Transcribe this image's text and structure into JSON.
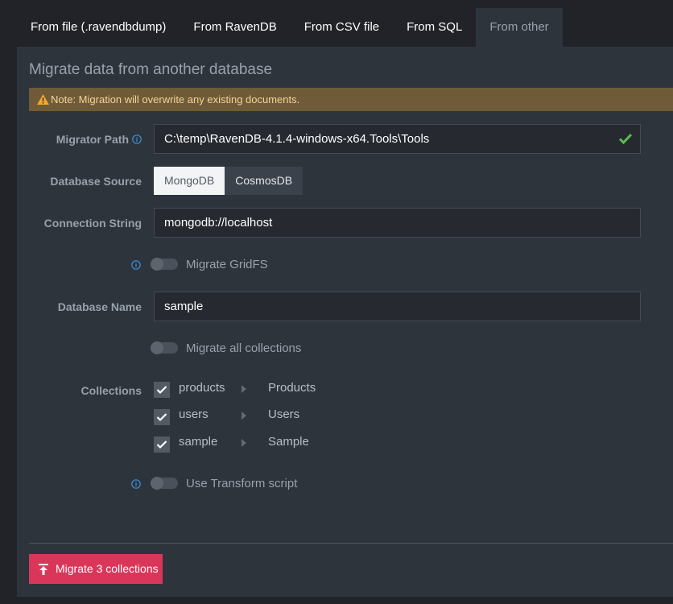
{
  "tabs": [
    {
      "label": "From file (.ravendbdump)",
      "active": false
    },
    {
      "label": "From RavenDB",
      "active": false
    },
    {
      "label": "From CSV file",
      "active": false
    },
    {
      "label": "From SQL",
      "active": false
    },
    {
      "label": "From other",
      "active": true
    }
  ],
  "panel": {
    "title": "Migrate data from another database",
    "warning": "Note: Migration will overwrite any existing documents."
  },
  "form": {
    "migrator_path_label": "Migrator Path",
    "migrator_path_value": "C:\\temp\\RavenDB-4.1.4-windows-x64.Tools\\Tools",
    "migrator_path_valid": true,
    "database_source_label": "Database Source",
    "database_source_options": [
      "MongoDB",
      "CosmosDB"
    ],
    "database_source_selected": "MongoDB",
    "connection_string_label": "Connection String",
    "connection_string_value": "mongodb://localhost",
    "migrate_gridfs_label": "Migrate GridFS",
    "migrate_gridfs_enabled": false,
    "database_name_label": "Database Name",
    "database_name_value": "sample",
    "migrate_all_label": "Migrate all collections",
    "migrate_all_enabled": false,
    "collections_label": "Collections",
    "collections": [
      {
        "source": "products",
        "target": "Products",
        "checked": true
      },
      {
        "source": "users",
        "target": "Users",
        "checked": true
      },
      {
        "source": "sample",
        "target": "Sample",
        "checked": true
      }
    ],
    "transform_label": "Use Transform script",
    "transform_enabled": false
  },
  "actions": {
    "migrate_label": "Migrate 3 collections"
  },
  "icons": {
    "warning": "warning-triangle-icon",
    "info": "info-circle-icon",
    "valid": "checkmark-icon",
    "migrate": "upload-icon",
    "arrow": "chevron-right-icon"
  },
  "colors": {
    "accent": "#d9365a",
    "info": "#3b8fdc",
    "success": "#5dbb4f",
    "warning_bg": "#6f5b38"
  }
}
